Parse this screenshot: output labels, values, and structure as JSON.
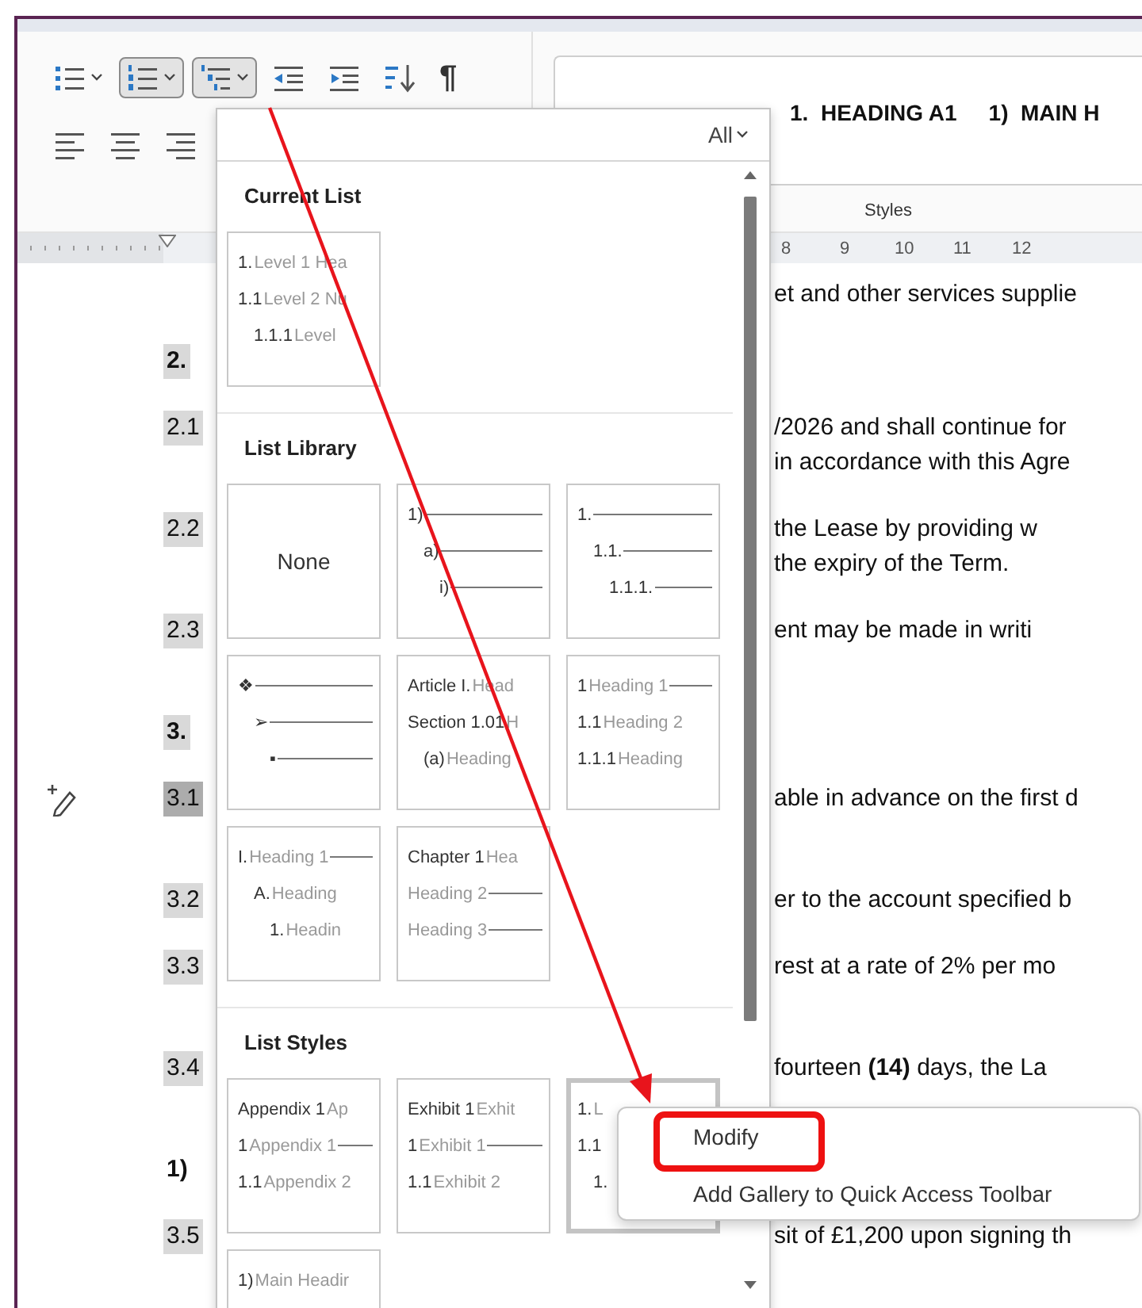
{
  "ribbon": {
    "paragraph_buttons": [
      {
        "kind": "bullets",
        "selected": false,
        "caret": true
      },
      {
        "kind": "numbering",
        "selected": true,
        "caret": true
      },
      {
        "kind": "multilevel",
        "selected": true,
        "caret": true
      },
      {
        "kind": "decrease-indent",
        "selected": false,
        "caret": false
      },
      {
        "kind": "increase-indent",
        "selected": false,
        "caret": false
      },
      {
        "kind": "sort",
        "selected": false,
        "caret": false
      },
      {
        "kind": "pilcrow",
        "selected": false,
        "caret": false,
        "glyph": "¶"
      }
    ],
    "align_buttons": [
      {
        "kind": "left",
        "selected": false
      },
      {
        "kind": "center",
        "selected": false
      },
      {
        "kind": "right",
        "selected": false
      }
    ],
    "styles_gallery": {
      "items": [
        "1.  HEADING A1",
        "1)  MAIN H"
      ],
      "group_label": "Styles"
    }
  },
  "ruler": {
    "numbers": [
      "8",
      "9",
      "10",
      "11",
      "12"
    ]
  },
  "document": {
    "paragraphs": [
      {
        "lines": [
          "et and other services supplie"
        ]
      },
      {
        "number": "2.",
        "shaded": true,
        "bold": true,
        "selected": false,
        "hidden_line": false
      },
      {
        "number": "2.1",
        "shaded": true,
        "bold": false,
        "selected": false,
        "hidden_line": false,
        "lines": [
          "/2026 and shall continue for",
          "in accordance with this Agre"
        ]
      },
      {
        "number": "2.2",
        "shaded": true,
        "bold": false,
        "selected": false,
        "hidden_line": false,
        "lines": [
          "the Lease by providing w",
          "the expiry of the Term."
        ]
      },
      {
        "number": "2.3",
        "shaded": true,
        "bold": false,
        "selected": false,
        "hidden_line": true,
        "lines": [
          "ent may be made in writi"
        ]
      },
      {
        "number": "3.",
        "shaded": true,
        "bold": true,
        "selected": false,
        "hidden_line": false
      },
      {
        "number": "3.1",
        "shaded": true,
        "bold": false,
        "selected": true,
        "hidden_line": true,
        "lines": [
          "able in advance on the first d"
        ]
      },
      {
        "number": "3.2",
        "shaded": true,
        "bold": false,
        "selected": false,
        "hidden_line": false,
        "lines": [
          "er to the account specified b"
        ]
      },
      {
        "number": "3.3",
        "shaded": true,
        "bold": false,
        "selected": false,
        "hidden_line": true,
        "lines": [
          "rest at a rate of 2% per mo"
        ]
      },
      {
        "number": "3.4",
        "shaded": true,
        "bold": false,
        "selected": false,
        "hidden_line": true,
        "lines": [
          "fourteen **(14)** days, the La"
        ]
      },
      {
        "number": "1)",
        "shaded": false,
        "bold": true,
        "selected": false,
        "hidden_line": false
      },
      {
        "number": "3.5",
        "shaded": true,
        "bold": false,
        "selected": false,
        "hidden_line": false,
        "lines": [
          "sit of £1,200 upon signing th"
        ]
      }
    ]
  },
  "list_gallery": {
    "filter": "All",
    "sections": [
      {
        "title": "Current List",
        "tiles": [
          {
            "kind": "list",
            "highlighted": false,
            "rows": [
              {
                "number": "1.",
                "label": "Level 1 Hea"
              },
              {
                "number": "1.1",
                "label": "Level 2 Nu",
                "children": [
                  {
                    "number": "1.1.1",
                    "label": "Level"
                  }
                ]
              }
            ]
          }
        ]
      },
      {
        "title": "List Library",
        "tiles": [
          {
            "kind": "none",
            "highlighted": false,
            "text": "None"
          },
          {
            "kind": "list",
            "highlighted": false,
            "rows": [
              {
                "number": "1)",
                "rule": true,
                "children": [
                  {
                    "number": "a)",
                    "rule": true,
                    "children": [
                      {
                        "number": "i)",
                        "rule": true
                      }
                    ]
                  }
                ]
              }
            ]
          },
          {
            "kind": "list",
            "highlighted": false,
            "rows": [
              {
                "number": "1.",
                "rule": true,
                "children": [
                  {
                    "number": "1.1.",
                    "rule": true,
                    "children": [
                      {
                        "number": "1.1.1.",
                        "rule": true
                      }
                    ]
                  }
                ]
              }
            ]
          },
          {
            "kind": "list",
            "highlighted": false,
            "rows": [
              {
                "number": "❖",
                "rule": true,
                "children": [
                  {
                    "number": "➢",
                    "rule": true,
                    "children": [
                      {
                        "number": "▪",
                        "rule": true
                      }
                    ]
                  }
                ]
              }
            ]
          },
          {
            "kind": "list",
            "highlighted": false,
            "rows": [
              {
                "number": "Article I.",
                "label": "Head"
              },
              {
                "number": "Section 1.01",
                "label": "H",
                "children": [
                  {
                    "number": "(a)",
                    "label": "Heading"
                  }
                ]
              }
            ]
          },
          {
            "kind": "list",
            "highlighted": false,
            "rows": [
              {
                "number": "1",
                "label": "Heading 1",
                "rule": true
              },
              {
                "number": "1.1",
                "label": "Heading 2"
              },
              {
                "number": "1.1.1",
                "label": "Heading"
              }
            ]
          },
          {
            "kind": "list",
            "highlighted": false,
            "rows": [
              {
                "number": "I.",
                "label": "Heading 1",
                "rule": true,
                "children": [
                  {
                    "number": "A.",
                    "label": "Heading",
                    "children": [
                      {
                        "number": "1.",
                        "label": "Headin"
                      }
                    ]
                  }
                ]
              }
            ]
          },
          {
            "kind": "list",
            "highlighted": false,
            "rows": [
              {
                "number": "Chapter 1",
                "label": "Hea"
              },
              {
                "label": "Heading 2",
                "rule": true
              },
              {
                "label": "Heading 3",
                "rule": true
              }
            ]
          }
        ]
      },
      {
        "title": "List Styles",
        "tiles": [
          {
            "kind": "list",
            "highlighted": false,
            "rows": [
              {
                "number": "Appendix 1",
                "label": "Ap"
              },
              {
                "number": "1",
                "label": "Appendix 1",
                "rule": true
              },
              {
                "number": "1.1",
                "label": "Appendix 2"
              }
            ]
          },
          {
            "kind": "list",
            "highlighted": false,
            "rows": [
              {
                "number": "Exhibit 1",
                "label": "Exhit"
              },
              {
                "number": "1",
                "label": "Exhibit 1",
                "rule": true
              },
              {
                "number": "1.1",
                "label": "Exhibit 2"
              }
            ]
          },
          {
            "kind": "list",
            "highlighted": true,
            "rows": [
              {
                "number": "1.",
                "label": "L"
              },
              {
                "number": "1.1",
                "children": [
                  {
                    "number": "1."
                  }
                ]
              }
            ]
          },
          {
            "kind": "list",
            "highlighted": false,
            "rows": [
              {
                "number": "1)",
                "label": "Main Headir"
              }
            ]
          }
        ]
      }
    ]
  },
  "context_menu": {
    "items": [
      {
        "label": "Modify",
        "highlighted": true
      },
      {
        "label": "Add Gallery to Quick Access Toolbar",
        "highlighted": false
      }
    ]
  },
  "annotation": {
    "arrow": true
  }
}
